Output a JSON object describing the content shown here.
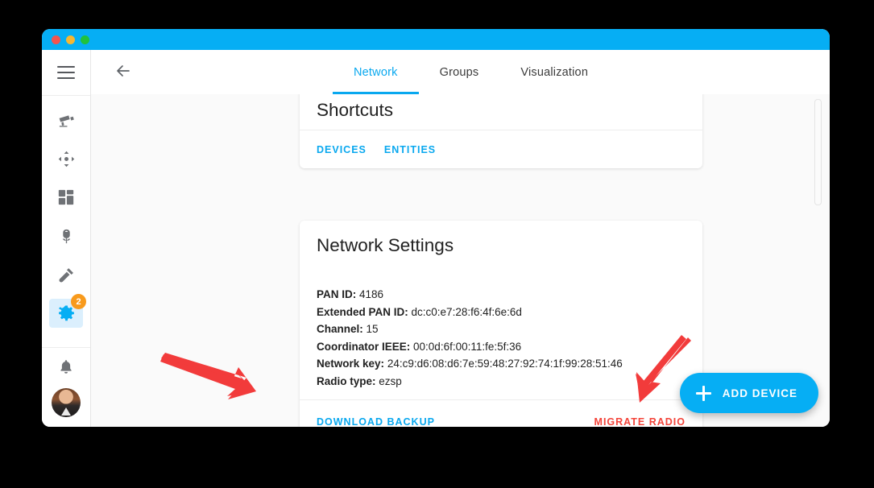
{
  "window": {
    "titlebar_color": "#06aef4",
    "traffic_lights": [
      "close",
      "minimize",
      "maximize"
    ]
  },
  "sidebar": {
    "menu_icon": "hamburger-icon",
    "items": [
      {
        "icon": "cctv-camera-icon",
        "active": false
      },
      {
        "icon": "move-arrows-icon",
        "active": false
      },
      {
        "icon": "dashboard-grid-icon",
        "active": false
      },
      {
        "icon": "flower-icon",
        "active": false
      },
      {
        "icon": "hammer-icon",
        "active": false
      },
      {
        "icon": "gear-icon",
        "active": true,
        "badge": "2"
      }
    ],
    "bottom": [
      {
        "icon": "bell-icon"
      },
      {
        "icon": "user-avatar"
      }
    ],
    "badge_color": "#f89a1c",
    "active_color": "#06aef4"
  },
  "header": {
    "back_icon": "arrow-left-icon",
    "tabs": [
      {
        "label": "Network",
        "active": true
      },
      {
        "label": "Groups",
        "active": false
      },
      {
        "label": "Visualization",
        "active": false
      }
    ],
    "accent_color": "#09a8ef"
  },
  "shortcuts_card": {
    "title": "Shortcuts",
    "actions": [
      {
        "label": "DEVICES",
        "style": "primary"
      },
      {
        "label": "ENTITIES",
        "style": "primary"
      }
    ]
  },
  "network_card": {
    "title": "Network Settings",
    "fields": [
      {
        "key": "PAN ID:",
        "value": "4186"
      },
      {
        "key": "Extended PAN ID:",
        "value": "dc:c0:e7:28:f6:4f:6e:6d"
      },
      {
        "key": "Channel:",
        "value": "15"
      },
      {
        "key": "Coordinator IEEE:",
        "value": "00:0d:6f:00:11:fe:5f:36"
      },
      {
        "key": "Network key:",
        "value": "24:c9:d6:08:d6:7e:59:48:27:92:74:1f:99:28:51:46"
      },
      {
        "key": "Radio type:",
        "value": "ezsp"
      }
    ],
    "actions": {
      "download": {
        "label": "DOWNLOAD BACKUP",
        "color": "#09a8ef"
      },
      "migrate": {
        "label": "MIGRATE RADIO",
        "color": "#f4443a"
      }
    }
  },
  "fab": {
    "icon": "plus-icon",
    "label": "ADD DEVICE",
    "color": "#06aef4"
  },
  "annotations": {
    "arrow_color": "#f23b3b",
    "arrows": [
      {
        "name": "arrow-to-download-backup",
        "points_to": "DOWNLOAD BACKUP"
      },
      {
        "name": "arrow-to-migrate-radio",
        "points_to": "MIGRATE RADIO"
      }
    ]
  }
}
